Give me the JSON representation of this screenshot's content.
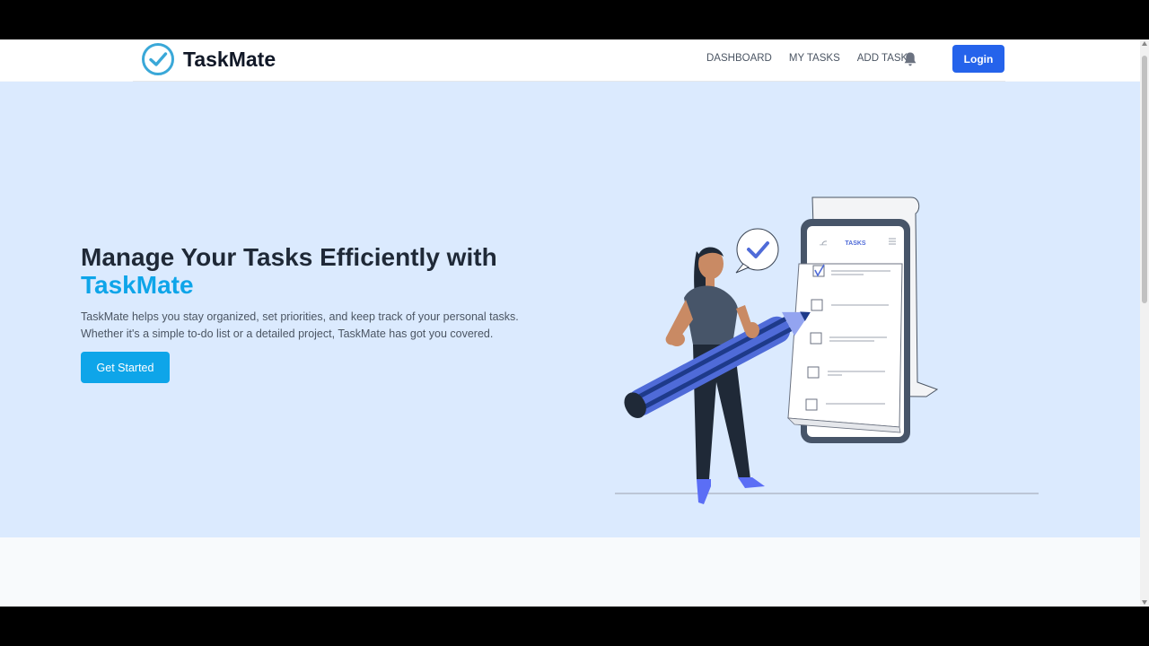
{
  "brand": {
    "name": "TaskMate",
    "logo_icon": "check-circle-icon",
    "accent_color": "#3aa8d8"
  },
  "nav": {
    "links": [
      "DASHBOARD",
      "MY TASKS",
      "ADD TASK"
    ],
    "bell_icon": "bell-icon",
    "login_label": "Login"
  },
  "hero": {
    "headline_part1": "Manage Your Tasks Efficiently with",
    "headline_accent": "TaskMate",
    "description_line1": "TaskMate helps you stay organized, set priorities, and keep track of your personal tasks.",
    "description_line2": "Whether it's a simple to-do list or a detailed project, TaskMate has got you covered.",
    "cta_label": "Get Started",
    "illustration": {
      "phone_title": "TASKS",
      "tasks_checked": [
        true,
        false,
        false,
        false,
        false
      ]
    }
  },
  "colors": {
    "hero_bg": "#dbeafe",
    "primary": "#2563eb",
    "accent": "#0ea5e9",
    "page_bg": "#f8fafc"
  }
}
